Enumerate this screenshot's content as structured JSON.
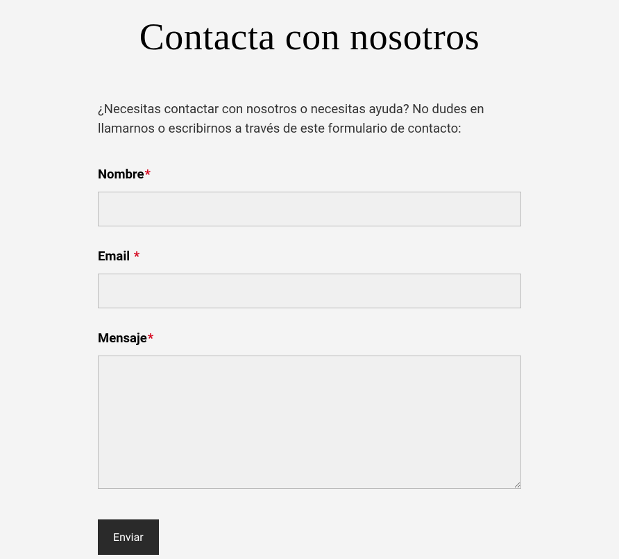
{
  "page": {
    "title": "Contacta con nosotros",
    "intro": "¿Necesitas contactar con nosotros o necesitas ayuda? No dudes en llamarnos o escribirnos a través de este formulario de contacto:"
  },
  "form": {
    "required_marker": "*",
    "fields": {
      "name": {
        "label": "Nombre",
        "value": ""
      },
      "email": {
        "label": "Email ",
        "value": ""
      },
      "message": {
        "label": "Mensaje",
        "value": ""
      }
    },
    "submit_label": "Enviar"
  }
}
